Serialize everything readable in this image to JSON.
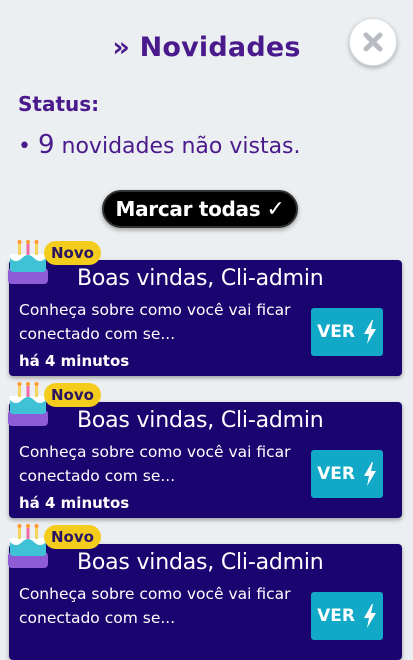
{
  "header": {
    "title": "» Novidades",
    "close_icon": "close-icon"
  },
  "status": {
    "label": "Status:",
    "bullet": "•",
    "count": "9",
    "text": "novidades não vistas."
  },
  "mark_all": {
    "label": "Marcar todas",
    "check": "✓"
  },
  "cards": [
    {
      "badge": "Novo",
      "title": "Boas vindas, Cli-admin",
      "description": "Conheça sobre como você vai ficar conectado com se...",
      "time": "há 4 minutos",
      "button": "VER",
      "icon": "cake-icon"
    },
    {
      "badge": "Novo",
      "title": "Boas vindas, Cli-admin",
      "description": "Conheça sobre como você vai ficar conectado com se...",
      "time": "há 4 minutos",
      "button": "VER",
      "icon": "cake-icon"
    },
    {
      "badge": "Novo",
      "title": "Boas vindas, Cli-admin",
      "description": "Conheça sobre como você vai ficar conectado com se...",
      "time": "",
      "button": "VER",
      "icon": "cake-icon"
    }
  ],
  "colors": {
    "background": "#eceff1",
    "accent_purple": "#4a1a8c",
    "card_bg": "#1a0470",
    "button_cyan": "#11a9c7",
    "badge_yellow": "#f4cc1c"
  }
}
